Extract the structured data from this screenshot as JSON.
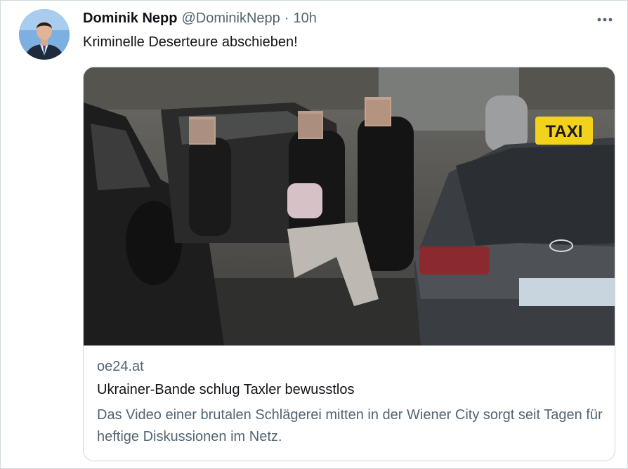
{
  "tweet": {
    "author_name": "Dominik Nepp",
    "author_handle": "@DominikNepp",
    "separator": "·",
    "time": "10h",
    "text": "Kriminelle Deserteure abschieben!",
    "more_icon": "more-horizontal-icon"
  },
  "card": {
    "domain": "oe24.at",
    "title": "Ukrainer-Bande schlug Taxler bewusstlos",
    "description": "Das Video einer brutalen Schlägerei mitten in der Wiener City sorgt seit Tagen für heftige Diskussionen im Netz.",
    "image_sign_text": "TAXI",
    "image_car_badge": "H"
  },
  "colors": {
    "text": "#0f1419",
    "secondary": "#536471",
    "border": "#cfd9de",
    "taxi_sign": "#f2d21a"
  }
}
